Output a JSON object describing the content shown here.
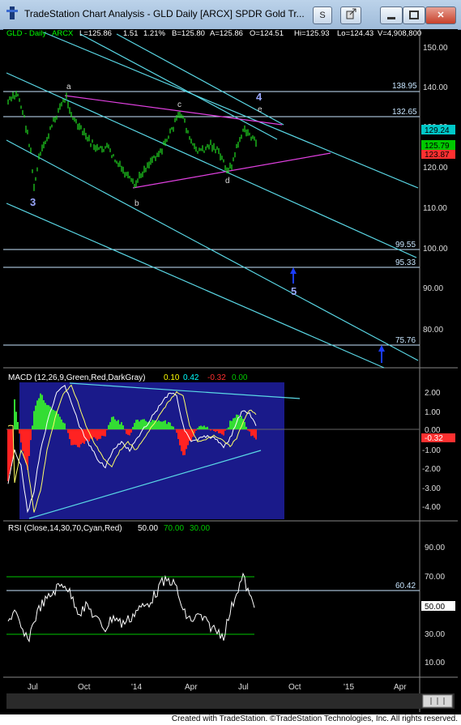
{
  "window": {
    "title": "TradeStation Chart Analysis - GLD Daily [ARCX] SPDR Gold Tr...",
    "buttons": {
      "s": "S",
      "link": "",
      "minimize": "",
      "maximize": "",
      "close": "✕"
    }
  },
  "price_panel": {
    "header": [
      {
        "text": "GLD - Daily",
        "color": "#00ff00"
      },
      {
        "text": "ARCX",
        "color": "#00ff00"
      },
      {
        "text": "L=125.86",
        "color": "#ffffff"
      },
      {
        "text": "1.51",
        "color": "#ffffff"
      },
      {
        "text": "1.21%",
        "color": "#ffffff"
      },
      {
        "text": "B=125.80",
        "color": "#ffffff"
      },
      {
        "text": "A=125.86",
        "color": "#ffffff"
      },
      {
        "text": "O=124.51",
        "color": "#ffffff"
      },
      {
        "text": "Hi=125.93",
        "color": "#ffffff"
      },
      {
        "text": "Lo=124.43",
        "color": "#ffffff"
      },
      {
        "text": "V=4,908,800",
        "color": "#ffffff"
      }
    ],
    "axis_ticks": [
      "150.00",
      "140.00",
      "130.00",
      "120.00",
      "110.00",
      "100.00",
      "90.00",
      "80.00"
    ],
    "level_labels": [
      "138.95",
      "132.65",
      "99.55",
      "95.33",
      "75.76"
    ],
    "price_badges": [
      {
        "value": "129.24",
        "bg": "#00c8c8"
      },
      {
        "value": "125.79",
        "bg": "#00c800"
      },
      {
        "value": "123.87",
        "bg": "#ff3030"
      }
    ],
    "wave_labels": {
      "a": "a",
      "b": "b",
      "c": "c",
      "d": "d",
      "e": "e",
      "w3": "3",
      "w4": "4",
      "w5": "5"
    }
  },
  "macd_panel": {
    "label": "MACD (12,26,9,Green,Red,DarkGray)",
    "values": [
      {
        "text": "0.10",
        "color": "#ffff00"
      },
      {
        "text": "0.42",
        "color": "#00ffff"
      },
      {
        "text": "-0.32",
        "color": "#ff3030"
      },
      {
        "text": "0.00",
        "color": "#00c800"
      }
    ],
    "axis_ticks": [
      "2.00",
      "1.00",
      "0.00",
      "-1.00",
      "-2.00",
      "-3.00",
      "-4.00"
    ],
    "badge": {
      "value": "-0.32",
      "bg": "#ff3030"
    }
  },
  "rsi_panel": {
    "label": "RSI (Close,14,30,70,Cyan,Red)",
    "values": [
      {
        "text": "50.00",
        "color": "#ffffff"
      },
      {
        "text": "70.00",
        "color": "#00c800"
      },
      {
        "text": "30.00",
        "color": "#00c800"
      }
    ],
    "axis_ticks": [
      "90.00",
      "70.00",
      "50.00",
      "30.00",
      "10.00"
    ],
    "level_label": "60.42",
    "badge": {
      "value": "50.00",
      "bg": "#ffffff"
    }
  },
  "time_axis": {
    "labels": [
      "Jul",
      "Oct",
      "'14",
      "Apr",
      "Jul",
      "Oct",
      "'15",
      "Apr"
    ]
  },
  "footer": "Created with TradeStation. ©TradeStation Technologies, Inc. All rights reserved."
}
